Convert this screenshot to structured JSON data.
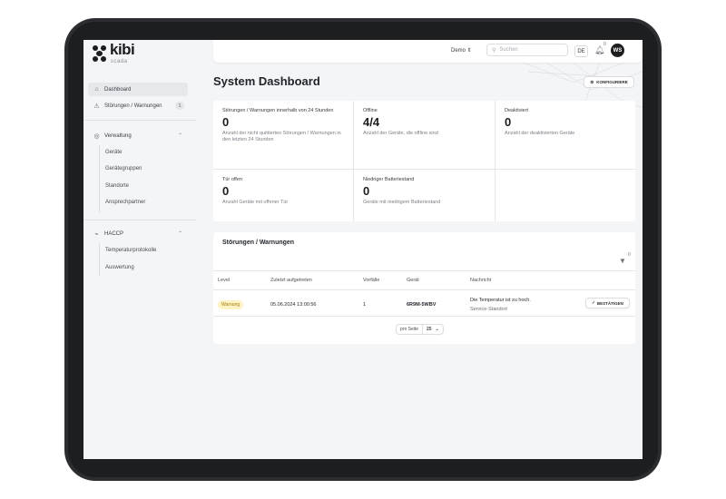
{
  "brand": {
    "name": "kibi",
    "sub": "scada"
  },
  "sidebar": {
    "items": [
      {
        "label": "Dashboard"
      },
      {
        "label": "Störungen / Warnungen",
        "badge": "1"
      },
      {
        "label": "Verwaltung"
      },
      {
        "label": "HACCP"
      }
    ],
    "verwaltung_sub": [
      "Geräte",
      "Gerätegruppen",
      "Standorte",
      "Ansprechpartner"
    ],
    "haccp_sub": [
      "Temperaturprotokolle",
      "Auswertung"
    ]
  },
  "topbar": {
    "tenant": "Demo ⇕",
    "search_placeholder": "Suchen",
    "lang": "DE",
    "notification_count": "0",
    "avatar": "WS"
  },
  "page": {
    "title": "System Dashboard",
    "configure_label": "KONFIGURIERE"
  },
  "kpis": [
    {
      "label": "Störungen / Warnungen innerhalb von 24 Stunden",
      "value": "0",
      "desc": "Anzahl der nicht quittierten Störungen / Warnungen in den letzten 24 Stunden"
    },
    {
      "label": "Offline",
      "value": "4/4",
      "desc": "Anzahl der Geräte, die offline sind"
    },
    {
      "label": "Deaktiviert",
      "value": "0",
      "desc": "Anzahl der deaktivierten Geräte"
    },
    {
      "label": "Tür offen",
      "value": "0",
      "desc": "Anzahl Geräte mit offener Tür"
    },
    {
      "label": "Niedriger Batteriestand",
      "value": "0",
      "desc": "Geräte mit niedrigem Batteriestand"
    }
  ],
  "alerts": {
    "title": "Störungen / Warnungen",
    "filter_count": "0",
    "columns": [
      "Level",
      "Zuletzt aufgetreten",
      "Vorfälle",
      "Gerät",
      "Nachricht"
    ],
    "rows": [
      {
        "level": "Warnung",
        "last": "05.06.2024 13:00:56",
        "count": "1",
        "device": "6R9M-5WBV",
        "message": "Die Temperatur ist zu hoch.",
        "location": "Service-Standort",
        "action": "BESTÄTIGEN"
      }
    ],
    "per_page_label": "pro Seite",
    "per_page_value": "25"
  }
}
